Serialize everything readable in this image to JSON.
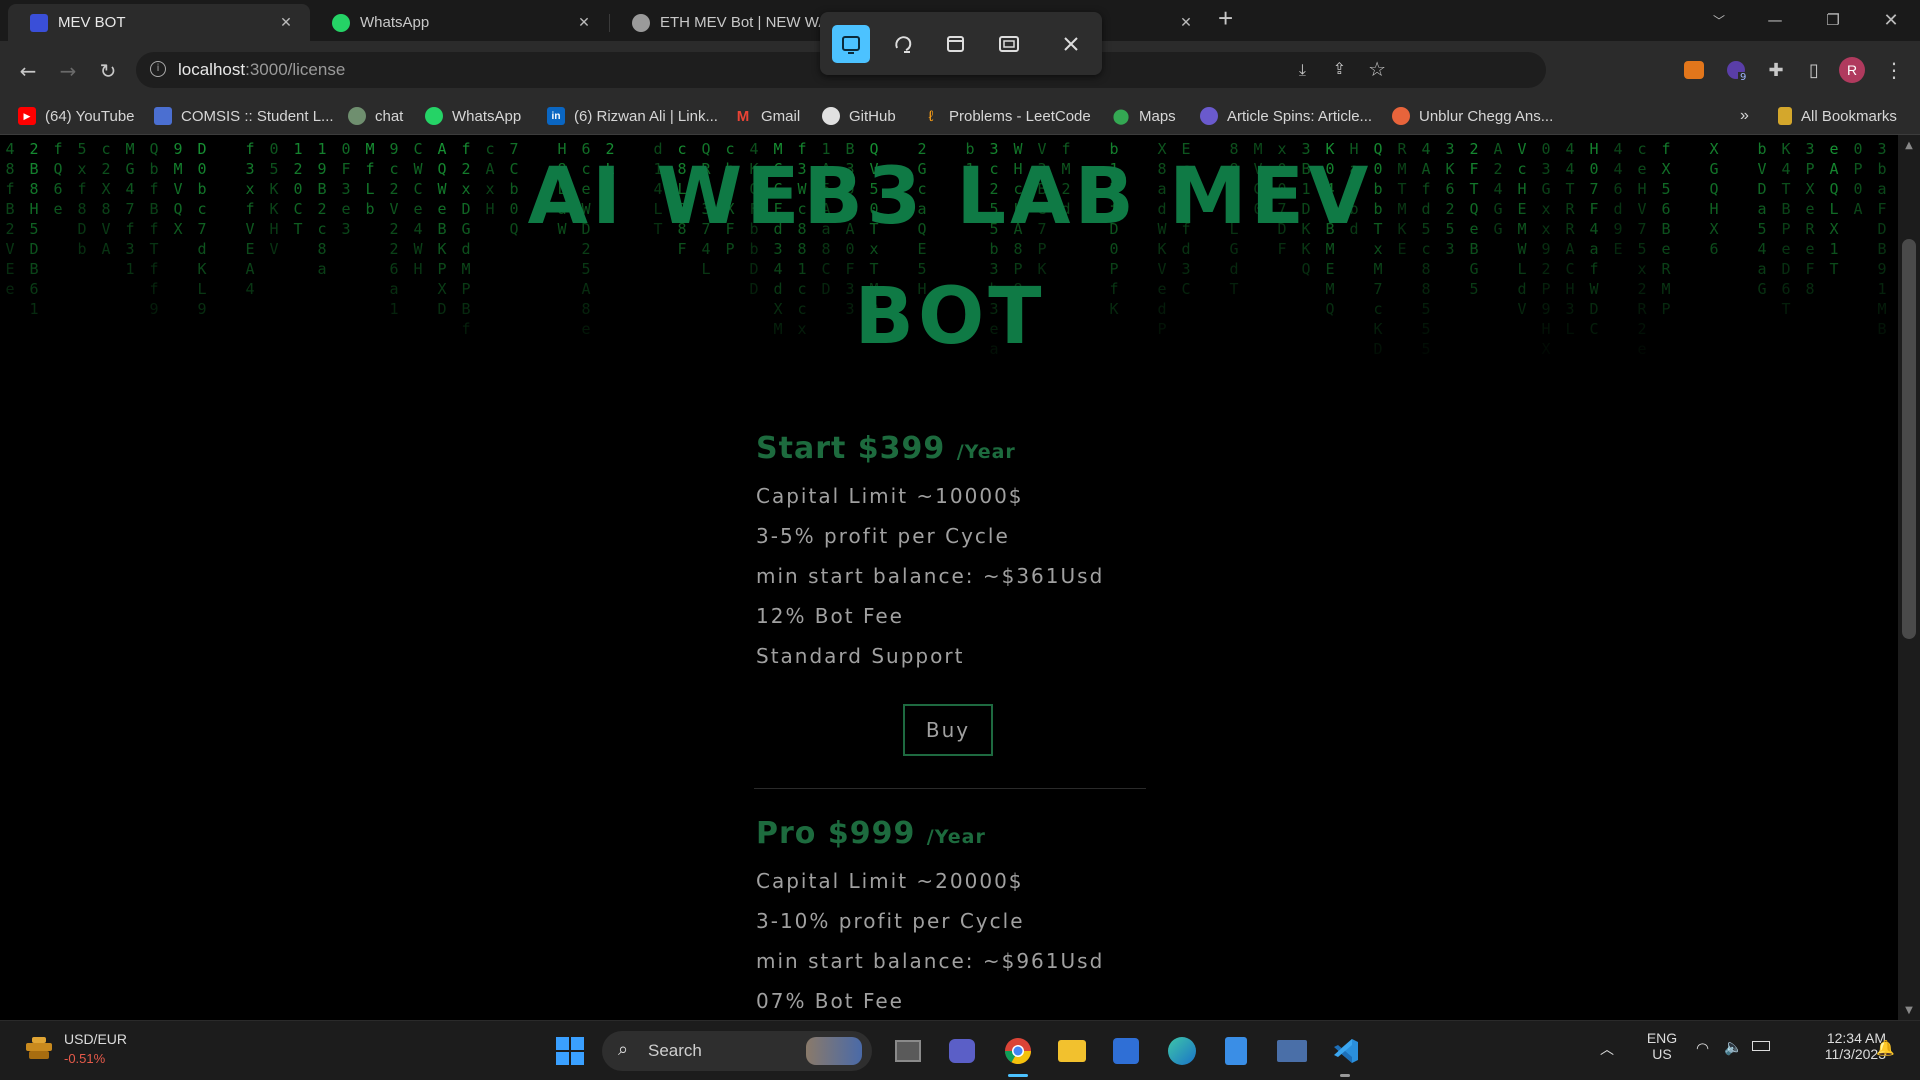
{
  "browser": {
    "tabs": [
      {
        "title": "MEV BOT",
        "active": true,
        "favicon_color": "#3a4fd8"
      },
      {
        "title": "WhatsApp",
        "active": false,
        "favicon_color": "#25d366"
      },
      {
        "title": "ETH MEV Bot | NEW WAL",
        "active": false,
        "favicon_color": "#9a9a9a"
      },
      {
        "title": "",
        "active": false,
        "favicon_color": "#25d366"
      }
    ],
    "new_tab_label": "+",
    "url_host": "localhost",
    "url_path": ":3000/license",
    "bookmarks": [
      {
        "label": "(64) YouTube",
        "icon": "youtube-icon",
        "color": "#ff0000"
      },
      {
        "label": "COMSIS :: Student L...",
        "icon": "comsis-icon",
        "color": "#4b6fd1"
      },
      {
        "label": "chat",
        "icon": "chat-icon",
        "color": "#6f8f6f"
      },
      {
        "label": "WhatsApp",
        "icon": "whatsapp-icon",
        "color": "#25d366"
      },
      {
        "label": "(6) Rizwan Ali | Link...",
        "icon": "linkedin-icon",
        "color": "#0a66c2"
      },
      {
        "label": "Gmail",
        "icon": "gmail-icon",
        "color": "#ea4335"
      },
      {
        "label": "GitHub",
        "icon": "github-icon",
        "color": "#e0e0e0"
      },
      {
        "label": "Problems - LeetCode",
        "icon": "leetcode-icon",
        "color": "#ffa116"
      },
      {
        "label": "Maps",
        "icon": "maps-icon",
        "color": "#34a853"
      },
      {
        "label": "Article Spins: Article...",
        "icon": "article-icon",
        "color": "#6a5acd"
      },
      {
        "label": "Unblur Chegg Ans...",
        "icon": "chegg-icon",
        "color": "#e8643b"
      }
    ],
    "overflow_label": "»",
    "all_bookmarks_label": "All Bookmarks",
    "profile_initial": "R",
    "extension_badge": "9"
  },
  "page": {
    "hero_title_line1": "AI WEB3 LAB MEV",
    "hero_title_line2": "BOT",
    "plans": [
      {
        "name_price": "Start $399",
        "period": "/Year",
        "features": [
          "Capital Limit ~10000$",
          "3-5% profit per Cycle",
          "min start balance: ~$361Usd",
          "12% Bot Fee",
          "Standard Support"
        ],
        "buy_label": "Buy"
      },
      {
        "name_price": "Pro $999",
        "period": "/Year",
        "features": [
          "Capital Limit ~20000$",
          "3-10% profit per Cycle",
          "min start balance: ~$961Usd",
          "07% Bot Fee"
        ]
      }
    ],
    "matrix_color": "#1aa33a",
    "title_color": "#0f7a45"
  },
  "taskbar": {
    "widget_title": "USD/EUR",
    "widget_value": "-0.51%",
    "search_placeholder": "Search",
    "lang_line1": "ENG",
    "lang_line2": "US",
    "time": "12:34 AM",
    "date": "11/3/2023"
  }
}
